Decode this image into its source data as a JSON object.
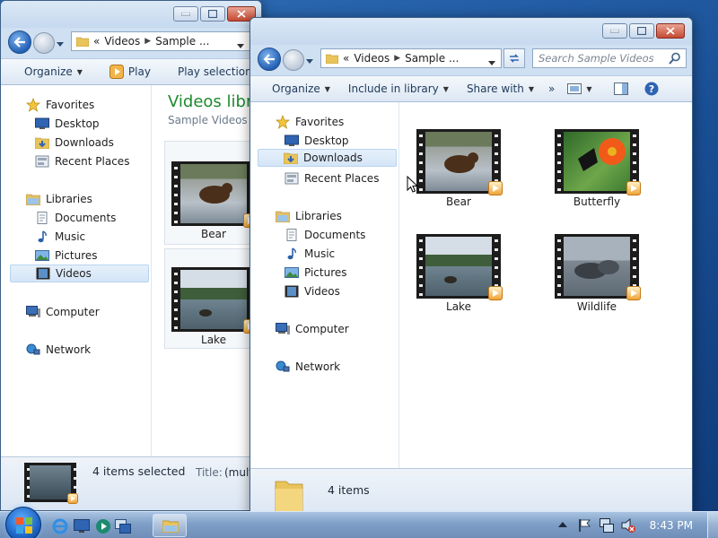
{
  "back_window": {
    "address": {
      "prefix": "«",
      "crumbs": [
        "Videos",
        "Sample ..."
      ]
    },
    "toolbar": {
      "organize": "Organize",
      "play": "Play",
      "play_selection": "Play selection"
    },
    "nav": {
      "favorites": "Favorites",
      "desktop": "Desktop",
      "downloads": "Downloads",
      "recent": "Recent Places",
      "libraries": "Libraries",
      "documents": "Documents",
      "music": "Music",
      "pictures": "Pictures",
      "videos": "Videos",
      "computer": "Computer",
      "network": "Network"
    },
    "header": {
      "title": "Videos libra",
      "subtitle": "Sample Videos"
    },
    "files": [
      "Bear",
      "Lake"
    ],
    "details": {
      "selected": "4 items selected",
      "title_label": "Title:",
      "title_value": "(mult"
    }
  },
  "front_window": {
    "address": {
      "prefix": "«",
      "crumbs": [
        "Videos",
        "Sample ..."
      ]
    },
    "search_placeholder": "Search Sample Videos",
    "toolbar": {
      "organize": "Organize",
      "include": "Include in library",
      "share": "Share with",
      "more": "»"
    },
    "nav": {
      "favorites": "Favorites",
      "desktop": "Desktop",
      "downloads": "Downloads",
      "recent": "Recent Places",
      "libraries": "Libraries",
      "documents": "Documents",
      "music": "Music",
      "pictures": "Pictures",
      "videos": "Videos",
      "computer": "Computer",
      "network": "Network"
    },
    "files": [
      "Bear",
      "Butterfly",
      "Lake",
      "Wildlife"
    ],
    "details": {
      "count": "4 items"
    }
  },
  "taskbar": {
    "clock": "8:43 PM"
  }
}
